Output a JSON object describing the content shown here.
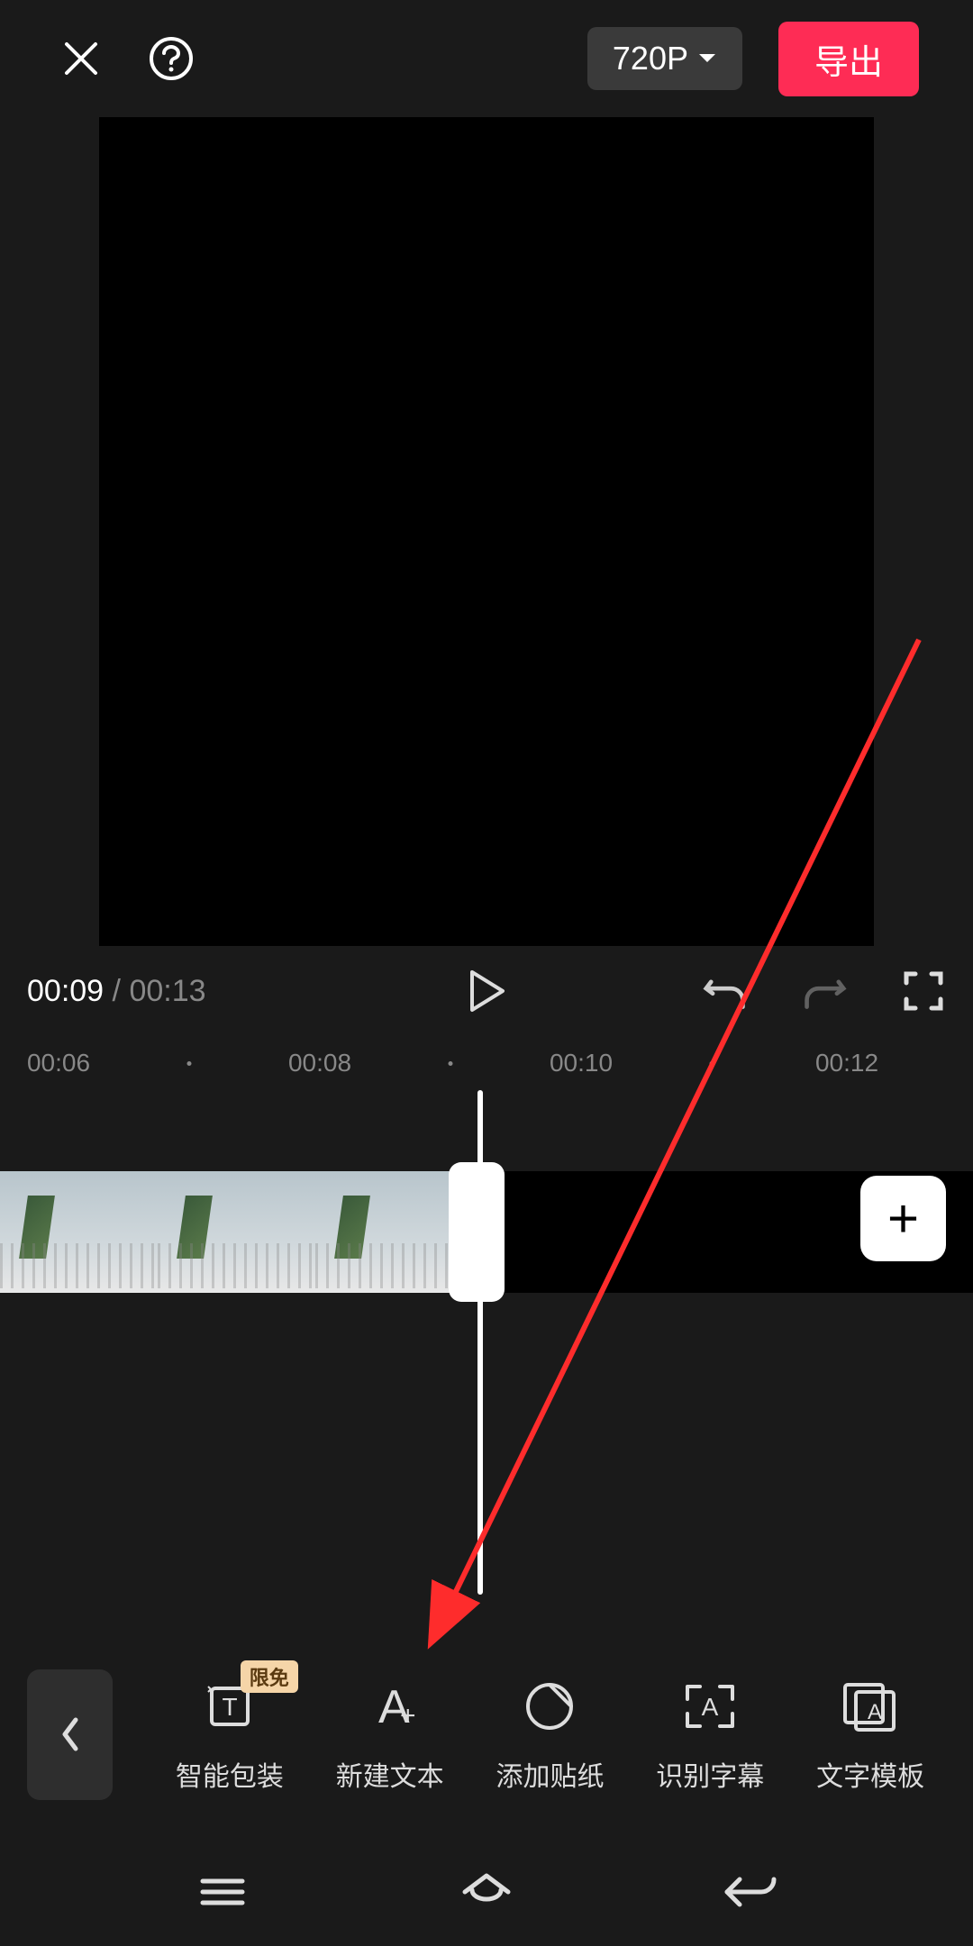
{
  "topbar": {
    "resolution_label": "720P",
    "export_label": "导出"
  },
  "player": {
    "current_time": "00:09",
    "total_time": "00:13",
    "separator": " / "
  },
  "ruler": {
    "marks": [
      "00:06",
      "00:08",
      "00:10",
      "00:12"
    ]
  },
  "toolbar": {
    "back_icon": "‹",
    "items": [
      {
        "label": "智能包装",
        "badge": "限免",
        "icon": "smart-pack"
      },
      {
        "label": "新建文本",
        "icon": "new-text"
      },
      {
        "label": "添加贴纸",
        "icon": "sticker"
      },
      {
        "label": "识别字幕",
        "icon": "subtitle"
      },
      {
        "label": "文字模板",
        "icon": "text-template"
      }
    ]
  },
  "add_clip_label": "+"
}
